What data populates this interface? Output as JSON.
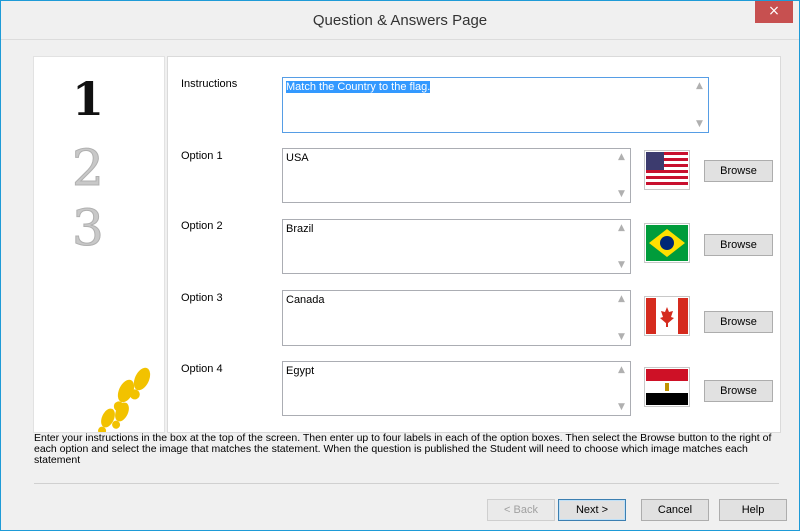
{
  "window": {
    "title": "Question & Answers Page",
    "close_label": "×"
  },
  "side_panel": {
    "numbers": [
      "1",
      "2",
      "3"
    ],
    "footprints_icon": "footprints-icon"
  },
  "instructions": {
    "label": "Instructions",
    "value": "Match the Country to the flag."
  },
  "options": [
    {
      "label": "Option 1",
      "value": "USA",
      "flag": "usa-flag-icon",
      "browse_label": "Browse"
    },
    {
      "label": "Option 2",
      "value": "Brazil",
      "flag": "brazil-flag-icon",
      "browse_label": "Browse"
    },
    {
      "label": "Option 3",
      "value": "Canada",
      "flag": "canada-flag-icon",
      "browse_label": "Browse"
    },
    {
      "label": "Option 4",
      "value": "Egypt",
      "flag": "egypt-flag-icon",
      "browse_label": "Browse"
    }
  ],
  "help_text": "Enter your instructions in the box at the top of the screen. Then enter up to four labels in each of the option boxes. Then select the Browse button to the right of each option and select the image that matches the statement. When the question is published the Student will need to choose which image matches each statement",
  "footer": {
    "back_label": "< Back",
    "next_label": "Next >",
    "cancel_label": "Cancel",
    "help_label": "Help"
  },
  "colors": {
    "window_border": "#1e9bd7",
    "close_button": "#c75050",
    "selection": "#3399ff",
    "footprints": "#f2c200"
  }
}
